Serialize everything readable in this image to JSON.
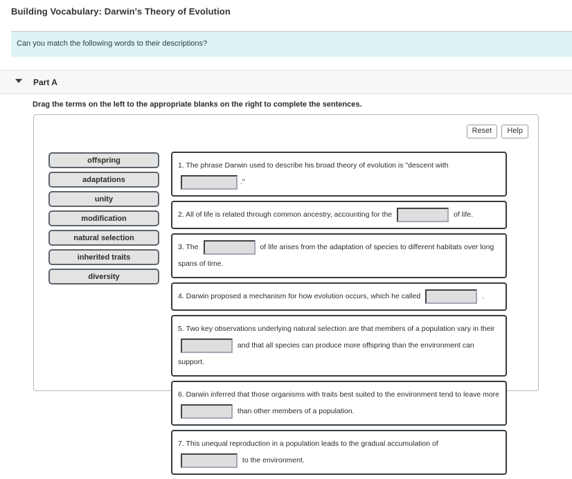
{
  "page": {
    "title": "Building Vocabulary: Darwin's Theory of Evolution"
  },
  "info_banner": {
    "text": "Can you match the following words to their descriptions?",
    "background_color": "#ddf4f7"
  },
  "part_section": {
    "toggle_icon": "chevron-down-icon",
    "label": "Part A",
    "instruction": "Drag the terms on the left to the appropriate blanks on the right to complete the sentences."
  },
  "toolbar": {
    "reset_label": "Reset",
    "help_label": "Help"
  },
  "terms": [
    {
      "label": "offspring"
    },
    {
      "label": "adaptations"
    },
    {
      "label": "unity"
    },
    {
      "label": "modification"
    },
    {
      "label": "natural selection"
    },
    {
      "label": "inherited traits"
    },
    {
      "label": "diversity"
    }
  ],
  "sentences": [
    {
      "number": "1.",
      "parts": [
        {
          "type": "text",
          "value": " The phrase Darwin used to describe his broad theory of evolution is \"descent with "
        },
        {
          "type": "blank",
          "value": ""
        },
        {
          "type": "text",
          "value": ".\""
        }
      ]
    },
    {
      "number": "2.",
      "parts": [
        {
          "type": "text",
          "value": " All of life is related through common ancestry, accounting for the "
        },
        {
          "type": "blank",
          "value": ""
        },
        {
          "type": "text",
          "value": " of life."
        }
      ]
    },
    {
      "number": "3.",
      "parts": [
        {
          "type": "text",
          "value": " The "
        },
        {
          "type": "blank",
          "value": ""
        },
        {
          "type": "text",
          "value": " of life arises from the adaptation of species to different habitats over long spans of time."
        }
      ]
    },
    {
      "number": "4.",
      "parts": [
        {
          "type": "text",
          "value": " Darwin proposed a mechanism for how evolution occurs, which he called "
        },
        {
          "type": "blank",
          "value": ""
        },
        {
          "type": "text",
          "value": " ."
        }
      ]
    },
    {
      "number": "5.",
      "parts": [
        {
          "type": "text",
          "value": " Two key observations underlying natural selection are that members of a population vary in their "
        },
        {
          "type": "blank",
          "value": ""
        },
        {
          "type": "text",
          "value": " and that all species can produce more offspring than the environment can support."
        }
      ]
    },
    {
      "number": "6.",
      "parts": [
        {
          "type": "text",
          "value": " Darwin inferred that those organisms with traits best suited to the environment tend to leave more "
        },
        {
          "type": "blank",
          "value": ""
        },
        {
          "type": "text",
          "value": " than other members of a population."
        }
      ]
    },
    {
      "number": "7.",
      "parts": [
        {
          "type": "text",
          "value": " This unequal reproduction in a population leads to the gradual accumulation of "
        },
        {
          "type": "blank",
          "value": ""
        },
        {
          "type": "text",
          "value": " to the environment."
        }
      ]
    }
  ]
}
